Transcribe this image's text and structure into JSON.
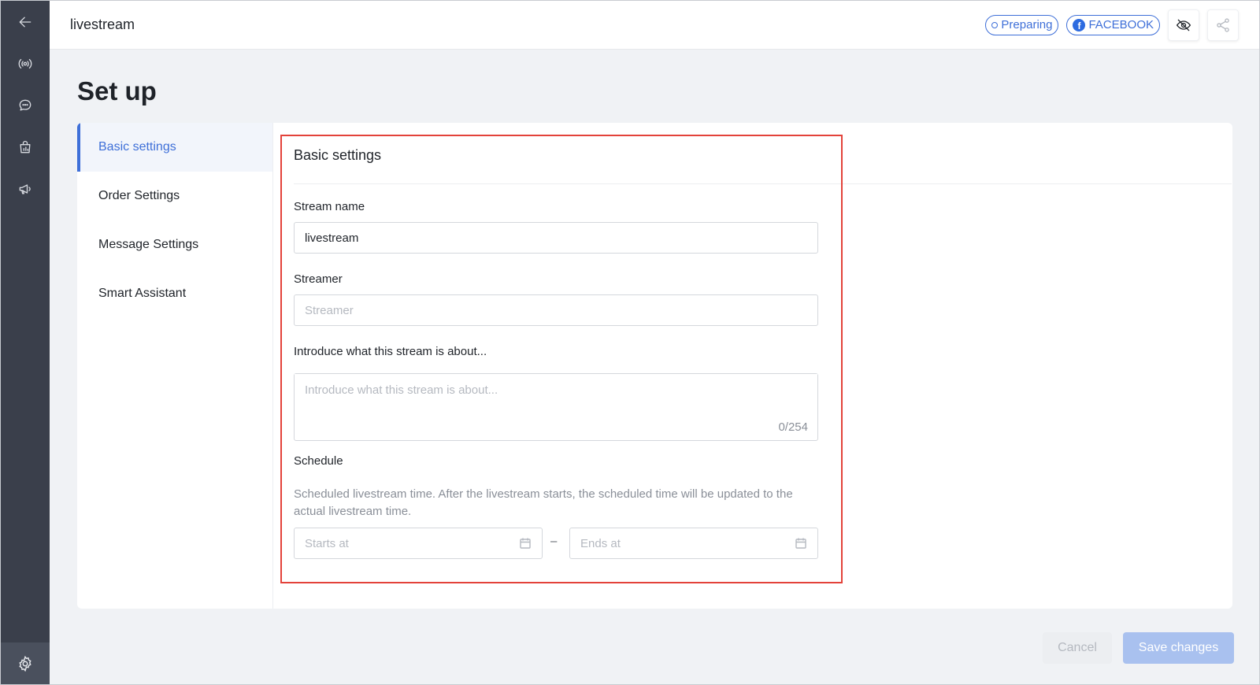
{
  "header": {
    "title": "livestream",
    "status_label": "Preparing",
    "platform_label": "FACEBOOK"
  },
  "rail": {
    "icons": [
      "back-arrow-icon",
      "broadcast-icon",
      "chat-icon",
      "shopping-bag-icon",
      "megaphone-icon"
    ],
    "bottom_icon": "gear-icon"
  },
  "page": {
    "title": "Set up"
  },
  "subnav": {
    "items": [
      {
        "label": "Basic settings",
        "active": true
      },
      {
        "label": "Order Settings",
        "active": false
      },
      {
        "label": "Message Settings",
        "active": false
      },
      {
        "label": "Smart Assistant",
        "active": false
      }
    ]
  },
  "form": {
    "section_title": "Basic settings",
    "stream_name": {
      "label": "Stream name",
      "value": "livestream"
    },
    "streamer": {
      "label": "Streamer",
      "placeholder": "Streamer"
    },
    "intro": {
      "label": "Introduce what this stream is about...",
      "placeholder": "Introduce what this stream is about...",
      "counter": "0/254"
    },
    "schedule": {
      "label": "Schedule",
      "help": "Scheduled livestream time. After the livestream starts, the scheduled time will be updated to the actual livestream time.",
      "starts_placeholder": "Starts at",
      "ends_placeholder": "Ends at",
      "separator": "–"
    }
  },
  "actions": {
    "cancel_label": "Cancel",
    "save_label": "Save changes"
  },
  "colors": {
    "accent": "#3e6fd8",
    "rail": "#3a3f4b",
    "highlight": "#e3423a"
  }
}
